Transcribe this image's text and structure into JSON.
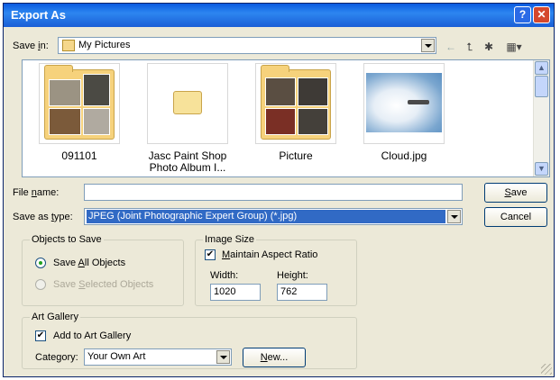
{
  "window": {
    "title": "Export As"
  },
  "save_in": {
    "label": "Save in:",
    "value": "My Pictures"
  },
  "toolbar": {
    "back_icon": "back-arrow-icon",
    "up_icon": "up-folder-icon",
    "new_folder_icon": "new-folder-icon",
    "views_icon": "views-menu-icon"
  },
  "files": [
    {
      "name": "091101",
      "kind": "folder"
    },
    {
      "name": "Jasc Paint Shop Photo Album I...",
      "kind": "folder"
    },
    {
      "name": "Picture",
      "kind": "folder"
    },
    {
      "name": "Cloud.jpg",
      "kind": "image"
    }
  ],
  "file_name": {
    "label": "File name:",
    "value": ""
  },
  "save_as_type": {
    "label": "Save as type:",
    "value": "JPEG (Joint Photographic Expert Group) (*.jpg)"
  },
  "buttons": {
    "save": "Save",
    "cancel": "Cancel",
    "new": "New..."
  },
  "objects_to_save": {
    "legend": "Objects to Save",
    "all": "Save All Objects",
    "selected": "Save Selected Objects",
    "selected_value": "all"
  },
  "image_size": {
    "legend": "Image Size",
    "maintain": "Maintain Aspect Ratio",
    "maintain_checked": true,
    "width_label": "Width:",
    "width": "1020",
    "height_label": "Height:",
    "height": "762"
  },
  "art_gallery": {
    "legend": "Art Gallery",
    "add": "Add to Art Gallery",
    "add_checked": true,
    "category_label": "Category:",
    "category": "Your Own Art"
  }
}
